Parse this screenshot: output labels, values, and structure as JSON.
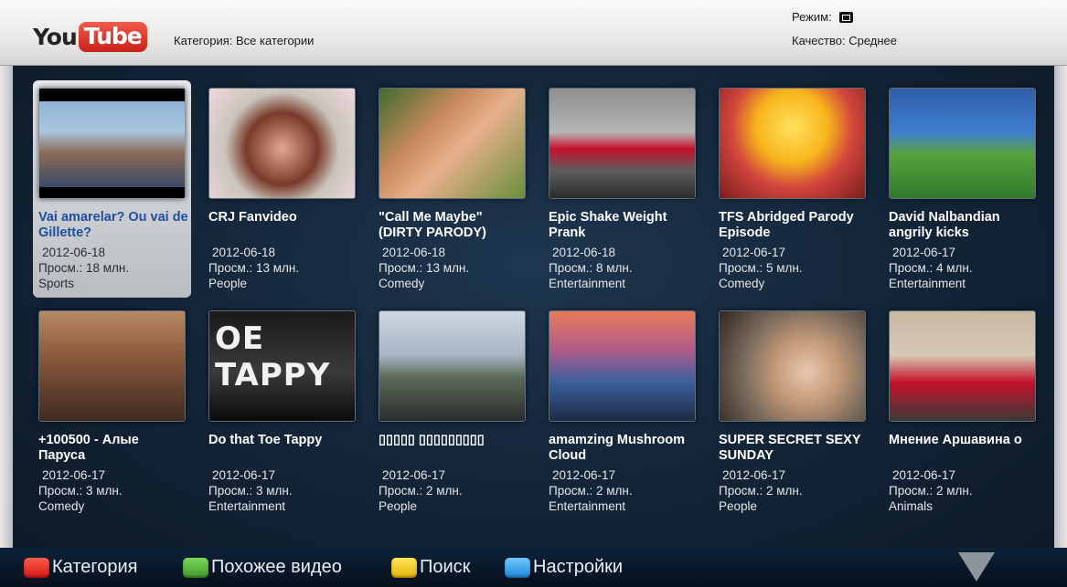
{
  "header": {
    "logo_you": "You",
    "logo_tube": "Tube",
    "category_label": "Категория:",
    "category_value": "Все категории",
    "mode_label": "Режим:",
    "quality_label": "Качество:",
    "quality_value": "Среднее"
  },
  "videos": [
    {
      "title": "Vai amarelar? Ou vai de Gillette?",
      "date": "2012-06-18",
      "views": "Просм.: 18 млн.",
      "category": "Sports",
      "selected": true
    },
    {
      "title": "CRJ Fanvideo",
      "date": "2012-06-18",
      "views": "Просм.: 13 млн.",
      "category": "People"
    },
    {
      "title": "\"Call Me Maybe\" (DIRTY PARODY)",
      "date": "2012-06-18",
      "views": "Просм.: 13 млн.",
      "category": "Comedy"
    },
    {
      "title": "Epic Shake Weight Prank",
      "date": "2012-06-18",
      "views": "Просм.: 8 млн.",
      "category": "Entertainment"
    },
    {
      "title": "TFS Abridged Parody Episode",
      "date": "2012-06-17",
      "views": "Просм.: 5 млн.",
      "category": "Comedy"
    },
    {
      "title": "David Nalbandian angrily kicks",
      "date": "2012-06-17",
      "views": "Просм.: 4 млн.",
      "category": "Entertainment"
    },
    {
      "title": "+100500 - Алые Паруса",
      "date": "2012-06-17",
      "views": "Просм.: 3 млн.",
      "category": "Comedy"
    },
    {
      "title": "Do that Toe Tappy",
      "date": "2012-06-17",
      "views": "Просм.: 3 млн.",
      "category": "Entertainment",
      "overlay": "OE TAPPY"
    },
    {
      "title": "▯▯▯▯▯ ▯▯▯▯▯▯▯▯▯",
      "date": "2012-06-17",
      "views": "Просм.: 2 млн.",
      "category": "People"
    },
    {
      "title": "amamzing Mushroom Cloud",
      "date": "2012-06-17",
      "views": "Просм.: 2 млн.",
      "category": "Entertainment"
    },
    {
      "title": "SUPER SECRET SEXY SUNDAY",
      "date": "2012-06-17",
      "views": "Просм.: 2 млн.",
      "category": "People"
    },
    {
      "title": "Мнение Аршавина о",
      "date": "2012-06-17",
      "views": "Просм.: 2 млн.",
      "category": "Animals"
    }
  ],
  "footer": {
    "buttons": [
      {
        "label": "Категория",
        "color": "red"
      },
      {
        "label": "Похожее видео",
        "color": "green"
      },
      {
        "label": "Поиск",
        "color": "yellow"
      },
      {
        "label": "Настройки",
        "color": "blue"
      }
    ],
    "scroll_icon": "down-arrow-icon"
  }
}
